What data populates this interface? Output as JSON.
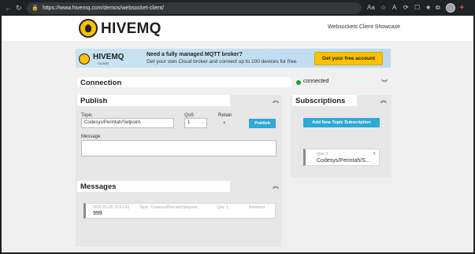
{
  "browser": {
    "back_icon": "←",
    "reload_icon": "↻",
    "lock_icon": "🔒",
    "url": "https://www.hivemq.com/demos/websocket-client/",
    "toolbar_icons": [
      "Aa",
      "☆",
      "A",
      "⟳",
      "☐",
      "★",
      "⧉"
    ]
  },
  "header": {
    "logo_text": "HIVEMQ",
    "showcase": "Websockets Client Showcase"
  },
  "banner": {
    "logo_text": "HIVEMQ",
    "logo_sub": "CLOUD",
    "title": "Need a fully managed MQTT broker?",
    "subtitle": "Get your own Cloud broker and connect up to 100 devices for free.",
    "button": "Get your free account"
  },
  "connection": {
    "title": "Connection",
    "status": "connected",
    "status_color": "#1f9d2a"
  },
  "publish": {
    "title": "Publish",
    "topic_label": "Topic",
    "topic_value": "Codesys/Perintah/Setpoint.",
    "qos_label": "QoS",
    "qos_value": "1",
    "retain_label": "Retain",
    "retain_value": "×",
    "publish_button": "Publish",
    "message_label": "Message",
    "message_value": ""
  },
  "subscriptions": {
    "title": "Subscriptions",
    "add_button": "Add New Topic Subscription",
    "items": [
      {
        "qos": "Qos: 1",
        "topic": "Codesys/Perintah/S...",
        "remove": "x"
      }
    ]
  },
  "messages": {
    "title": "Messages",
    "items": [
      {
        "timestamp": "2025-01-05 15:51:43",
        "topic": "Topic: Codesys/Perintah/Setpoint.",
        "qos": "Qos: 1",
        "retained": "Retained",
        "payload": "999"
      }
    ]
  },
  "colors": {
    "accent": "#2ea8d6",
    "brand": "#ffc000"
  }
}
